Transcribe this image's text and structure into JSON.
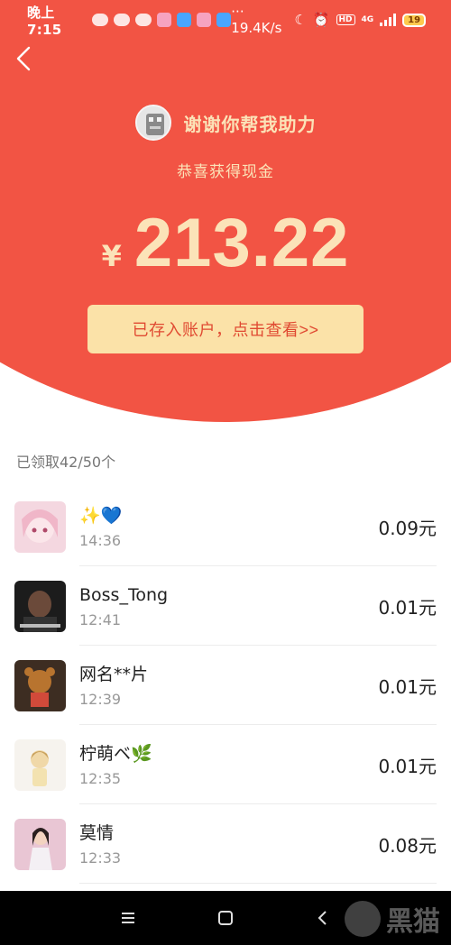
{
  "status_bar": {
    "time": "晚上7:15",
    "speed": "··· 19.4K/s",
    "network": "4G",
    "battery": "19"
  },
  "header": {
    "back_icon": "chevron-left-icon",
    "sender_name": "谢谢你帮我助力",
    "congrats": "恭喜获得现金",
    "currency": "¥",
    "amount": "213.22",
    "cta_label": "已存入账户，点击查看>>"
  },
  "claimed_summary": "已领取42/50个",
  "records": [
    {
      "name": "✨💙",
      "time": "14:36",
      "amount": "0.09元"
    },
    {
      "name": "Boss_Tong",
      "time": "12:41",
      "amount": "0.01元"
    },
    {
      "name": "网名**片",
      "time": "12:39",
      "amount": "0.01元"
    },
    {
      "name": "柠萌ベ🌿",
      "time": "12:35",
      "amount": "0.01元"
    },
    {
      "name": "莫情",
      "time": "12:33",
      "amount": "0.08元"
    }
  ],
  "colors": {
    "hero_red": "#f25444",
    "gold_text": "#fbe3b8",
    "cta_bg": "#fbe2a8"
  },
  "watermark": "黑猫"
}
